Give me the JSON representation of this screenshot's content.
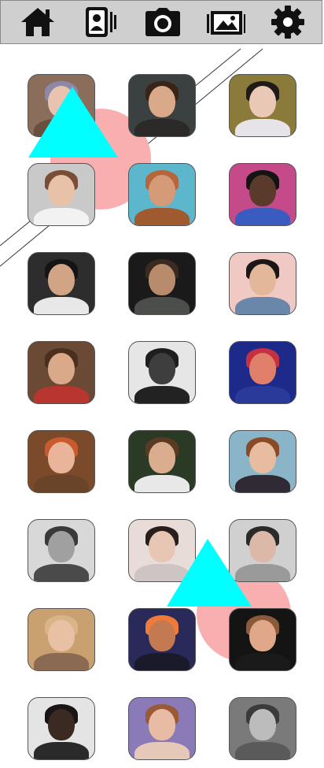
{
  "toolbar": {
    "icons": [
      "home-icon",
      "contacts-icon",
      "camera-icon",
      "gallery-icon",
      "gear-icon"
    ]
  },
  "photos": [
    {
      "name": "photo-1",
      "bg": "#8a6d5a",
      "skin": "#e8c4b0",
      "hair": "#8e88a8",
      "top": "#6a4f3e"
    },
    {
      "name": "photo-2",
      "bg": "#3b4140",
      "skin": "#d9a98a",
      "hair": "#3a2418",
      "top": "#2c2a28"
    },
    {
      "name": "photo-3",
      "bg": "#8a7b3a",
      "skin": "#e9c9b5",
      "hair": "#1e1a18",
      "top": "#e6e4e8"
    },
    {
      "name": "photo-4",
      "bg": "#c9c9c9",
      "skin": "#e7c2a8",
      "hair": "#7a4e34",
      "top": "#f2f2f2"
    },
    {
      "name": "photo-5",
      "bg": "#5db7cc",
      "skin": "#d59b78",
      "hair": "#b5673b",
      "top": "#a05a30"
    },
    {
      "name": "photo-6",
      "bg": "#c44a8a",
      "skin": "#5a3a2a",
      "hair": "#141414",
      "top": "#3a5bc0"
    },
    {
      "name": "photo-7",
      "bg": "#2d2d2d",
      "skin": "#d0a484",
      "hair": "#141414",
      "top": "#e8e8e8"
    },
    {
      "name": "photo-8",
      "bg": "#1a1a1a",
      "skin": "#b88b6c",
      "hair": "#3a2a20",
      "top": "#4b4e4a"
    },
    {
      "name": "photo-9",
      "bg": "#f0c9c4",
      "skin": "#e3b89a",
      "hair": "#1b1716",
      "top": "#6a86a8"
    },
    {
      "name": "photo-10",
      "bg": "#6a4a34",
      "skin": "#d9a98a",
      "hair": "#4a2e1e",
      "top": "#b8362f"
    },
    {
      "name": "photo-11",
      "bg": "#e6e6e6",
      "skin": "#3e3e3e",
      "hair": "#1e1e1e",
      "top": "#222222"
    },
    {
      "name": "photo-12",
      "bg": "#1d2a8a",
      "skin": "#e0806a",
      "hair": "#c63040",
      "top": "#2a3a9a"
    },
    {
      "name": "photo-13",
      "bg": "#7a4a2a",
      "skin": "#eab49a",
      "hair": "#c85a2e",
      "top": "#6a4428"
    },
    {
      "name": "photo-14",
      "bg": "#2a3a24",
      "skin": "#d9ad8e",
      "hair": "#5a3a22",
      "top": "#e8e8e8"
    },
    {
      "name": "photo-15",
      "bg": "#8ab4c8",
      "skin": "#e8bca0",
      "hair": "#8a4a28",
      "top": "#2f2a34"
    },
    {
      "name": "photo-16",
      "bg": "#d8d8d8",
      "skin": "#a0a0a0",
      "hair": "#3a3a3a",
      "top": "#4a4a4a"
    },
    {
      "name": "photo-17",
      "bg": "#e8dcd8",
      "skin": "#e8c6b4",
      "hair": "#2a1e1c",
      "top": "#cfc4c4"
    },
    {
      "name": "photo-18",
      "bg": "#d0d0d0",
      "skin": "#dcb8a8",
      "hair": "#2a2a2a",
      "top": "#9a9a9a"
    },
    {
      "name": "photo-19",
      "bg": "#c9a070",
      "skin": "#e8c0a4",
      "hair": "#d8b488",
      "top": "#8a6a52"
    },
    {
      "name": "photo-20",
      "bg": "#2a2a5a",
      "skin": "#c47a50",
      "hair": "#f07a3a",
      "top": "#1a1a2a"
    },
    {
      "name": "photo-21",
      "bg": "#141414",
      "skin": "#e0a888",
      "hair": "#8a5a3a",
      "top": "#1a1a1a"
    },
    {
      "name": "photo-22",
      "bg": "#e4e4e4",
      "skin": "#3a2a22",
      "hair": "#1a1414",
      "top": "#2a2a2a"
    },
    {
      "name": "photo-23",
      "bg": "#8a7ab8",
      "skin": "#e8bca4",
      "hair": "#9a5a38",
      "top": "#e6c8b8"
    },
    {
      "name": "photo-24",
      "bg": "#7a7a7a",
      "skin": "#bcbcbc",
      "hair": "#3a3a3a",
      "top": "#5a5a5a"
    }
  ]
}
